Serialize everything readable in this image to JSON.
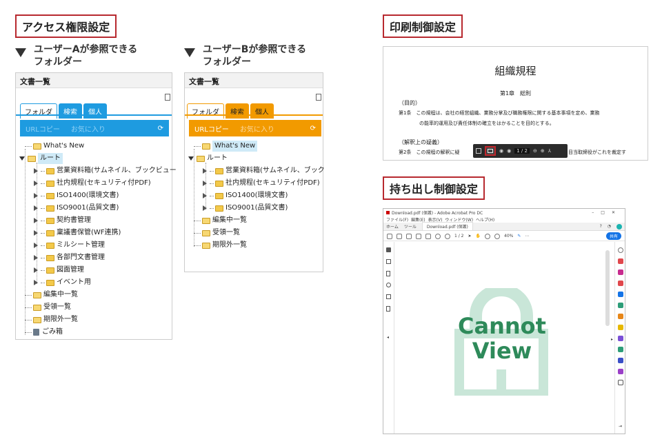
{
  "sections": {
    "access": "アクセス権限設定",
    "print": "印刷制御設定",
    "takeout": "持ち出し制御設定"
  },
  "userA": {
    "heading_line1": "ユーザーAが参照できる",
    "heading_line2": "フォルダー",
    "panel_title": "文書一覧",
    "tabs": [
      "フォルダ",
      "検索",
      "個人"
    ],
    "toolbar_items": [
      "URLコピー",
      "お気に入り"
    ],
    "tree": {
      "whatsnew": "What's New",
      "root": "ルート",
      "folders": [
        "営業資料箱(サムネイル、ブックビュー",
        "社内規程(セキュリティ付PDF)",
        "ISO1400(環境文書)",
        "ISO9001(品質文書)",
        "契約書管理",
        "稟議書保管(WF連携)",
        "ミルシート管理",
        "各部門文書管理",
        "図面管理",
        "イベント用"
      ],
      "editing": "編集中一覧",
      "receiving": "受領一覧",
      "expired": "期限外一覧",
      "trash": "ごみ箱"
    }
  },
  "userB": {
    "heading_line1": "ユーザーBが参照できる",
    "heading_line2": "フォルダー",
    "panel_title": "文書一覧",
    "tabs": [
      "フォルダ",
      "検索",
      "個人"
    ],
    "toolbar_items": [
      "URLコピー",
      "お気に入り"
    ],
    "tree": {
      "whatsnew": "What's New",
      "root": "ルート",
      "folders": [
        "営業資料箱(サムネイル、ブック",
        "社内規程(セキュリティ付PDF)",
        "ISO1400(環境文書)",
        "ISO9001(品質文書)"
      ],
      "editing": "編集中一覧",
      "receiving": "受領一覧",
      "expired": "期限外一覧"
    }
  },
  "document": {
    "title": "組織規程",
    "chapter": "第1章　総則",
    "item1_heading": "（目的）",
    "item1_line1": "第1条　この規程は、会社の経営組織、業務分掌及び職務権限に関する基本事項を定め、業務",
    "item1_line2": "の能率的運用及び責任体制の確立をはかることを目的とする。",
    "item2_heading": "（解釈上の疑義）",
    "item2_prefix": "第2条　この規程の解釈に疑",
    "item2_suffix": "目当取締役がこれを裁定す",
    "page_indicator": "1 / 2"
  },
  "acrobat": {
    "window_title": "Download.pdf (保護) - Adobe Acrobat Pro DC",
    "menu": [
      "ファイル(F)",
      "編集(E)",
      "表示(V)",
      "ウィンドウ(W)",
      "ヘルプ(H)"
    ],
    "tabs": [
      "ホーム",
      "ツール",
      "Download.pdf (保護)"
    ],
    "page_indicator": "1 / 2",
    "zoom": "40%",
    "share_button": "共有",
    "cannot_line1": "Cannot",
    "cannot_line2": "View",
    "colors": {
      "lock": "#c9e6d8",
      "text": "#2e8a5a",
      "accent": "#1473e6"
    }
  },
  "colors": {
    "section_border": "#b7282e",
    "userA_accent": "#1e9be0",
    "userB_accent": "#f29a00"
  }
}
